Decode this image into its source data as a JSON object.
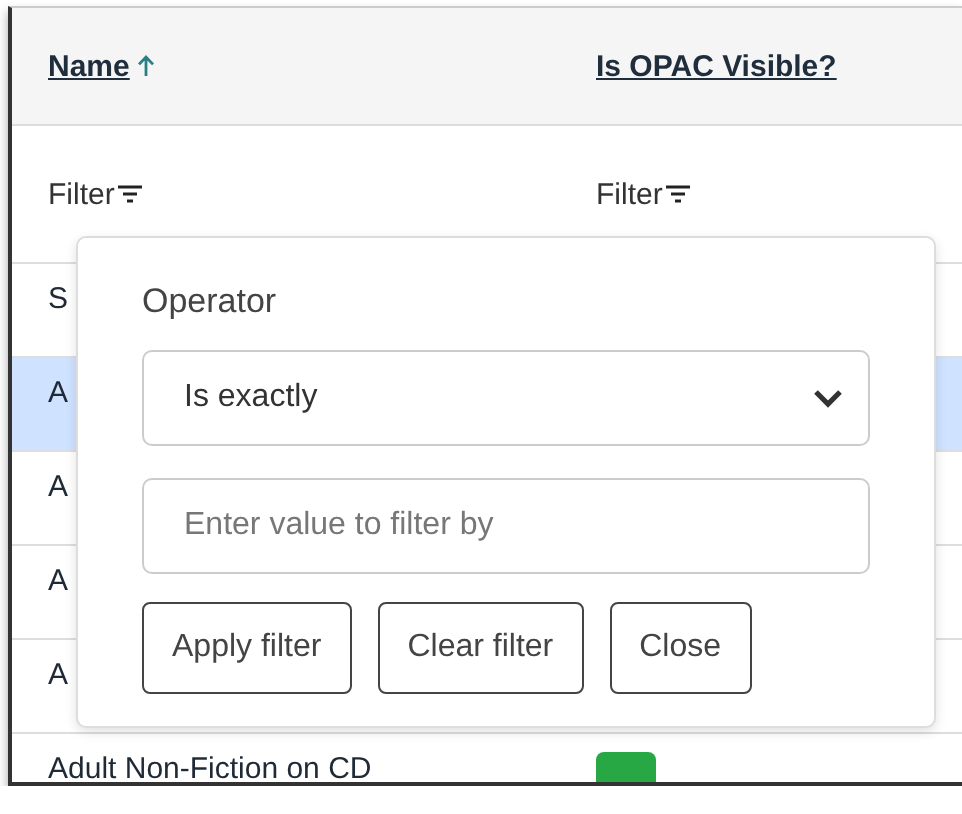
{
  "table": {
    "columns": [
      {
        "label": "Name",
        "sorted": true
      },
      {
        "label": "Is OPAC Visible?",
        "sorted": false
      }
    ],
    "filters": [
      "Filter",
      "Filter"
    ],
    "rows": [
      {
        "name": "S",
        "selected": false
      },
      {
        "name": "A",
        "selected": true
      },
      {
        "name": "A",
        "selected": false
      },
      {
        "name": "A",
        "selected": false
      },
      {
        "name": "A",
        "selected": false
      },
      {
        "name": "Adult Non-Fiction on CD",
        "selected": false,
        "opac_visible": true
      }
    ]
  },
  "filter_popup": {
    "operator_label": "Operator",
    "operator": "Is exactly",
    "value_placeholder": "Enter value to filter by",
    "buttons": [
      "Apply filter",
      "Clear filter",
      "Close"
    ]
  }
}
